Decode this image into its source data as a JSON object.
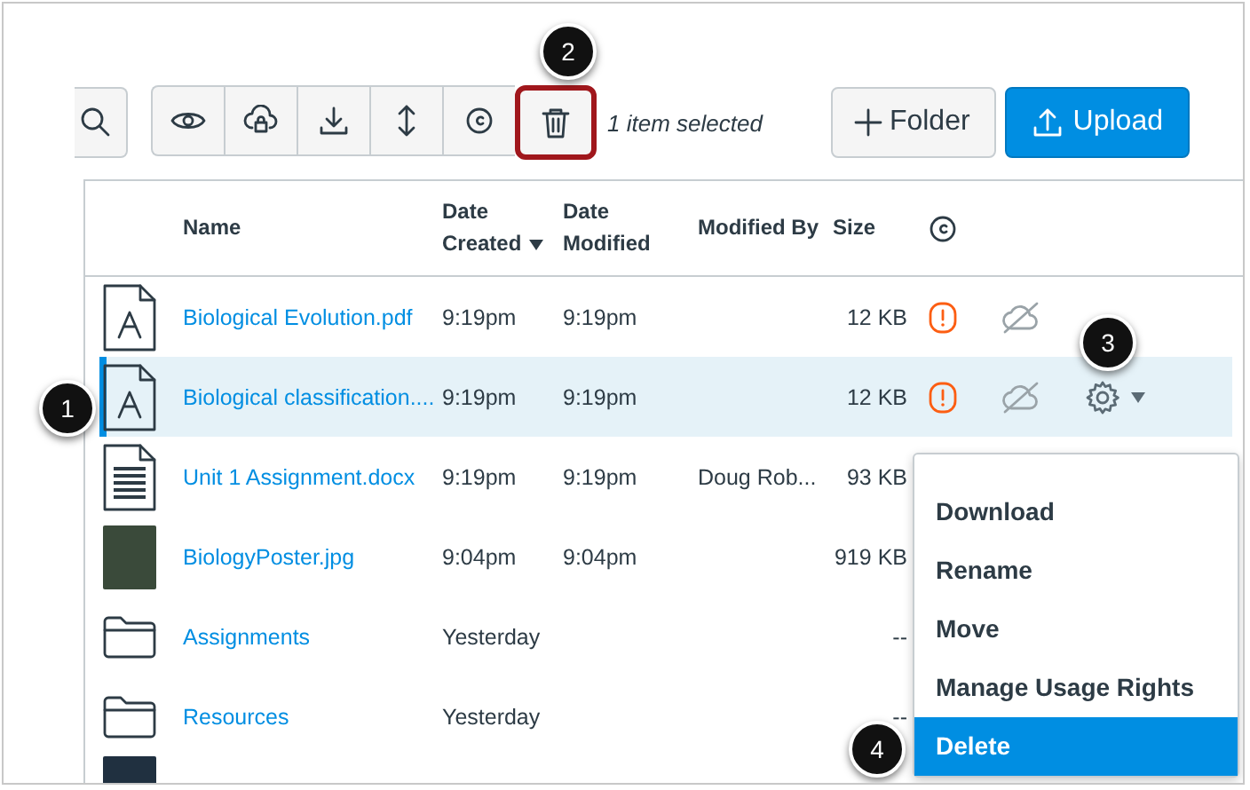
{
  "toolbar": {
    "buttons": [
      {
        "kind": "search",
        "highlighted": false
      },
      {
        "kind": "view",
        "highlighted": false
      },
      {
        "kind": "restrict",
        "highlighted": false
      },
      {
        "kind": "download",
        "highlighted": false
      },
      {
        "kind": "move",
        "highlighted": false
      },
      {
        "kind": "usage",
        "highlighted": false
      },
      {
        "kind": "delete",
        "highlighted": true
      }
    ],
    "selection_text": "1 item selected",
    "folder_button": "Folder",
    "upload_button": "Upload"
  },
  "table": {
    "columns": [
      {
        "label": "Name",
        "sorted": false
      },
      {
        "label": "Date Created",
        "sorted": true
      },
      {
        "label": "Date Modified",
        "sorted": false
      },
      {
        "label": "Modified By",
        "sorted": false
      },
      {
        "label": "Size",
        "sorted": false
      }
    ],
    "rows": [
      {
        "kind": "pdf",
        "name": "Biological Evolution.pdf",
        "created": "9:19pm",
        "modified": "9:19pm",
        "modified_by": "",
        "size": "12 KB",
        "usage_warning": true,
        "unpublished": true,
        "selected": false
      },
      {
        "kind": "pdf",
        "name": "Biological classification....",
        "created": "9:19pm",
        "modified": "9:19pm",
        "modified_by": "",
        "size": "12 KB",
        "usage_warning": true,
        "unpublished": true,
        "selected": true
      },
      {
        "kind": "doc",
        "name": "Unit 1 Assignment.docx",
        "created": "9:19pm",
        "modified": "9:19pm",
        "modified_by": "Doug Rob...",
        "size": "93 KB",
        "usage_warning": false,
        "unpublished": false,
        "selected": false
      },
      {
        "kind": "image",
        "name": "BiologyPoster.jpg",
        "created": "9:04pm",
        "modified": "9:04pm",
        "modified_by": "",
        "size": "919 KB",
        "usage_warning": false,
        "unpublished": false,
        "selected": false
      },
      {
        "kind": "folder",
        "name": "Assignments",
        "created": "Yesterday",
        "modified": "",
        "modified_by": "",
        "size": "--",
        "usage_warning": false,
        "unpublished": false,
        "selected": false
      },
      {
        "kind": "folder",
        "name": "Resources",
        "created": "Yesterday",
        "modified": "",
        "modified_by": "",
        "size": "--",
        "usage_warning": false,
        "unpublished": false,
        "selected": false
      }
    ]
  },
  "menu": {
    "items": [
      {
        "label": "Download",
        "selected": false
      },
      {
        "label": "Rename",
        "selected": false
      },
      {
        "label": "Move",
        "selected": false
      },
      {
        "label": "Manage Usage Rights",
        "selected": false
      },
      {
        "label": "Delete",
        "selected": true
      }
    ]
  },
  "callouts": [
    {
      "number": "1"
    },
    {
      "number": "2"
    },
    {
      "number": "3"
    },
    {
      "number": "4"
    }
  ]
}
